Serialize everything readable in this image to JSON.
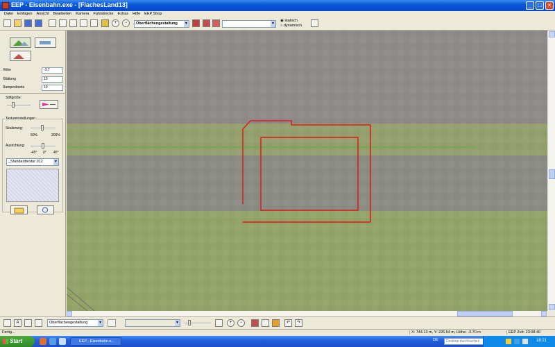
{
  "window": {
    "title": "EEP - Eisenbahn.exe - [FlachesLand13]"
  },
  "menu": [
    "Datei",
    "Einfügen",
    "Ansicht",
    "Bearbeiten",
    "Kamera",
    "Fahrstrecke",
    "Extras",
    "Hilfe",
    "EEP Shop"
  ],
  "toolbar": {
    "mode_combo": "Oberflächengestaltung",
    "empty_combo": "",
    "radio_static": "statisch",
    "radio_dynamic": "dynamisch"
  },
  "leftpanel": {
    "props": [
      {
        "label": "Höhe",
        "value": "-3.7"
      },
      {
        "label": "Glättung",
        "value": "10"
      },
      {
        "label": "Rampenbreite",
        "value": "10"
      }
    ],
    "brush_size_label": "Stiftgröße:",
    "texture_group_label": "Textureinstellungen",
    "scaling_label": "Skalierung:",
    "scale_min": "50%",
    "scale_max": "200%",
    "alignment_label": "Ausrichtung:",
    "align_min": "-45°",
    "align_mid": "0°",
    "align_max": "45°",
    "texture_select": "_Standardtextur 012"
  },
  "bottombar": {
    "mode_combo": "Oberflächengestaltung"
  },
  "status": {
    "left": "Fertig...",
    "coords": "X: 744.13 m, Y: 226.54 m, Höhe: -3.70 m",
    "time": "EEP Zeit: 23:08:40"
  },
  "taskbar": {
    "start": "Start",
    "task": "EEP - Eisenbahn.e...",
    "lang": "DE",
    "search_placeholder": "Desktop durchsuchen",
    "clock": "18:21"
  },
  "colors": {
    "ground_top": "#8d8a86",
    "grass": "#98a86a",
    "selection_red": "#e01818"
  }
}
